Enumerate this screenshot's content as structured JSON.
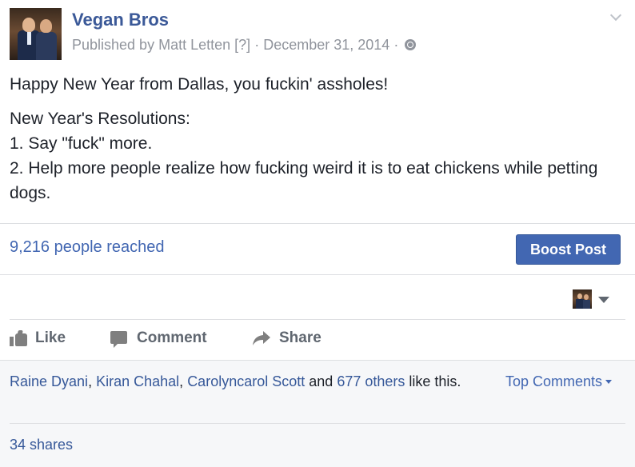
{
  "header": {
    "page_name": "Vegan Bros",
    "published_prefix": "Published by",
    "publisher": "Matt Letten",
    "help_marker": "[?]",
    "separator": "·",
    "date": "December 31, 2014",
    "privacy_icon": "globe-icon",
    "menu_icon": "chevron-down-icon"
  },
  "post": {
    "line1": "Happy New Year from Dallas, you fuckin' assholes!",
    "line2": "New Year's Resolutions:",
    "line3": "1. Say \"fuck\" more.",
    "line4": "2. Help more people realize how fucking weird it is to eat chickens while petting dogs."
  },
  "insights": {
    "reach": "9,216 people reached",
    "boost_label": "Boost Post"
  },
  "actions": {
    "like": "Like",
    "comment": "Comment",
    "share": "Share"
  },
  "summary": {
    "liker1": "Raine Dyani",
    "comma": ",",
    "liker2": "Kiran Chahal",
    "liker3": "Carolyncarol Scott",
    "and": "and",
    "others": "677 others",
    "like_suffix": "like this.",
    "top_comments": "Top Comments",
    "shares": "34 shares"
  },
  "colors": {
    "link_blue": "#3b5998",
    "button_blue": "#4267b2",
    "muted_gray": "#90949c",
    "summary_bg": "#f6f7f9"
  }
}
